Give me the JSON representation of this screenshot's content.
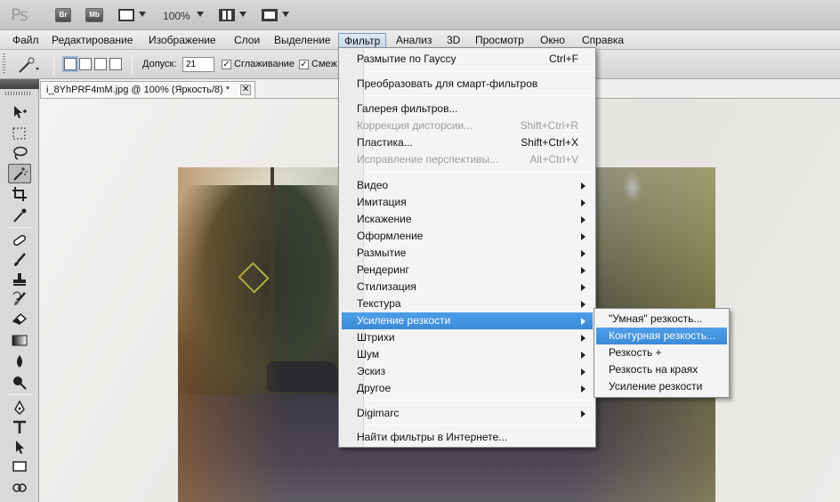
{
  "appbar": {
    "logo": "Ps",
    "bridge_label": "Br",
    "minibridge_label": "Mb",
    "zoom": "100%"
  },
  "menubar": {
    "items": [
      "Файл",
      "Редактирование",
      "Изображение",
      "Слои",
      "Выделение",
      "Фильтр",
      "Анализ",
      "3D",
      "Просмотр",
      "Окно",
      "Справка"
    ],
    "active": "Фильтр"
  },
  "options": {
    "tolerance_label": "Допуск:",
    "tolerance_value": "21",
    "antialias_label": "Сглаживание",
    "antialias_checked": true,
    "contiguous_label": "Смеж.",
    "contiguous_checked": true
  },
  "document": {
    "tab_title": "i_8YhPRF4mM.jpg @ 100% (Яркость/8) *",
    "close_glyph": "✕"
  },
  "filter_menu": {
    "items": [
      {
        "label": "Размытие по Гауссу",
        "shortcut": "Ctrl+F"
      },
      {
        "label": "Преобразовать для смарт-фильтров"
      },
      {
        "label": "Галерея фильтров..."
      },
      {
        "label": "Коррекция дисторсии...",
        "shortcut": "Shift+Ctrl+R",
        "disabled": true
      },
      {
        "label": "Пластика...",
        "shortcut": "Shift+Ctrl+X"
      },
      {
        "label": "Исправление перспективы...",
        "shortcut": "Alt+Ctrl+V",
        "disabled": true
      },
      {
        "label": "Видео",
        "submenu": true
      },
      {
        "label": "Имитация",
        "submenu": true
      },
      {
        "label": "Искажение",
        "submenu": true
      },
      {
        "label": "Оформление",
        "submenu": true
      },
      {
        "label": "Размытие",
        "submenu": true
      },
      {
        "label": "Рендеринг",
        "submenu": true
      },
      {
        "label": "Стилизация",
        "submenu": true
      },
      {
        "label": "Текстура",
        "submenu": true
      },
      {
        "label": "Усиление резкости",
        "submenu": true,
        "highlighted": true
      },
      {
        "label": "Штрихи",
        "submenu": true
      },
      {
        "label": "Шум",
        "submenu": true
      },
      {
        "label": "Эскиз",
        "submenu": true
      },
      {
        "label": "Другое",
        "submenu": true
      },
      {
        "label": "Digimarc",
        "submenu": true
      },
      {
        "label": "Найти фильтры в Интернете..."
      }
    ]
  },
  "sharpen_submenu": {
    "items": [
      {
        "label": "\"Умная\" резкость..."
      },
      {
        "label": "Контурная резкость...",
        "highlighted": true
      },
      {
        "label": "Резкость +"
      },
      {
        "label": "Резкость на краях"
      },
      {
        "label": "Усиление резкости"
      }
    ]
  },
  "colors": {
    "highlight": "#3b8ad8",
    "menu_bg": "#f4f4f4",
    "disabled_text": "#9c9c9c"
  }
}
